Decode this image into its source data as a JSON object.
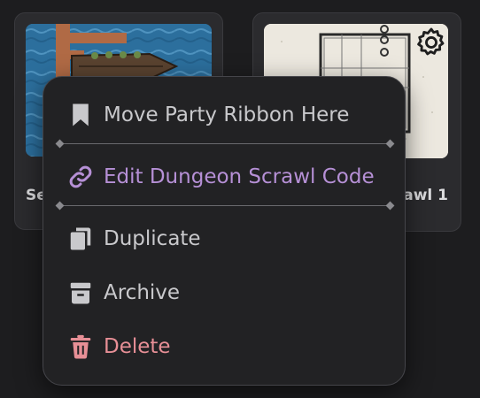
{
  "cards": [
    {
      "title": "Se"
    },
    {
      "title": "rawl 1"
    }
  ],
  "menu": {
    "items": [
      {
        "label": "Move Party Ribbon Here",
        "icon": "bookmark-icon"
      },
      {
        "label": "Edit Dungeon Scrawl Code",
        "icon": "link-icon"
      },
      {
        "label": "Duplicate",
        "icon": "copy-icon"
      },
      {
        "label": "Archive",
        "icon": "archive-icon"
      },
      {
        "label": "Delete",
        "icon": "trash-icon"
      }
    ]
  },
  "colors": {
    "background": "#1d1d1f",
    "menu_text": "#c9c9cc",
    "accent": "#b690d6",
    "danger": "#e78f96"
  }
}
